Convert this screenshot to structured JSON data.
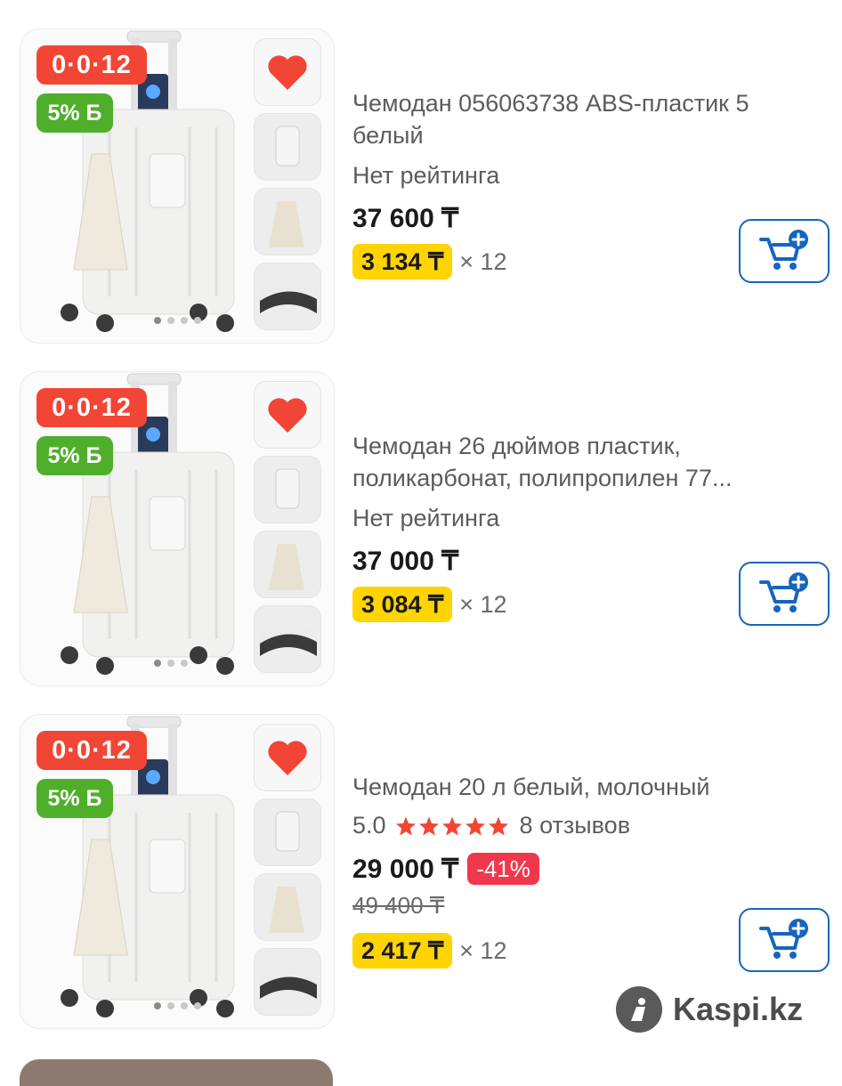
{
  "products": [
    {
      "installment_badge": "0·0·12",
      "bonus_badge": "5% Б",
      "title_lines": [
        "Чемодан 056063738 ABS-пластик 5",
        "белый"
      ],
      "rating_text": "Нет рейтинга",
      "price": "37 600 ₸",
      "monthly_payment": "3 134 ₸",
      "term": "× 12"
    },
    {
      "installment_badge": "0·0·12",
      "bonus_badge": "5% Б",
      "title_lines": [
        "Чемодан 26 дюймов пластик,",
        "поликарбонат, полипропилен 77..."
      ],
      "rating_text": "Нет рейтинга",
      "price": "37 000 ₸",
      "monthly_payment": "3 084 ₸",
      "term": "× 12"
    },
    {
      "installment_badge": "0·0·12",
      "bonus_badge": "5% Б",
      "title_lines": [
        "Чемодан 20 л белый, молочный"
      ],
      "rating_value": "5.0",
      "stars": 5,
      "reviews": "8 отзывов",
      "price": "29 000 ₸",
      "discount": "-41%",
      "old_price": "49 400 ₸",
      "monthly_payment": "2 417 ₸",
      "term": "× 12"
    }
  ],
  "watermark": "Kaspi.kz",
  "colors": {
    "installment_badge": "#f14635",
    "bonus_badge": "#4faf2b",
    "monthly_pill": "#ffd400",
    "cart_accent": "#1565c0",
    "heart": "#f14635",
    "star": "#f14635",
    "discount": "#f0384d"
  },
  "icons": [
    "heart-icon",
    "cart-add-icon",
    "star-icon",
    "kaspi-logo-icon"
  ]
}
